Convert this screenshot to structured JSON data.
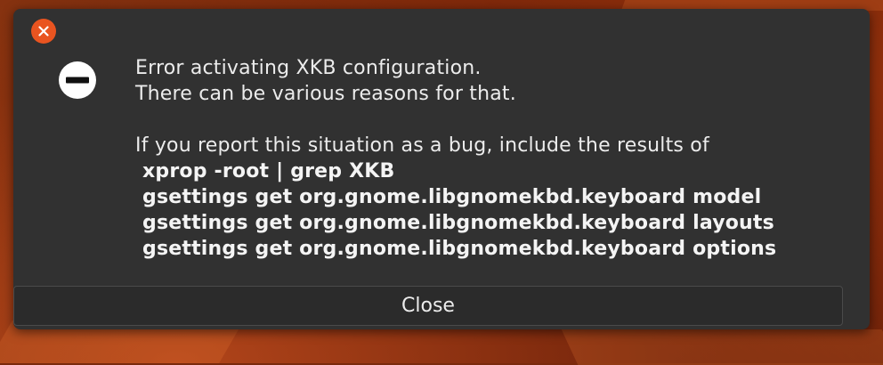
{
  "colors": {
    "accent": "#e95420",
    "dialog_bg": "#313131",
    "text": "#ececec"
  },
  "titlebar": {
    "close_icon": "close-icon"
  },
  "icon": {
    "name": "dialog-error-icon"
  },
  "message": {
    "line1": "Error activating XKB configuration.",
    "line2": "There can be various reasons for that.",
    "line3": "If you report this situation as a bug, include the results of",
    "commands": [
      "xprop -root | grep XKB",
      "gsettings get org.gnome.libgnomekbd.keyboard model",
      "gsettings get org.gnome.libgnomekbd.keyboard layouts",
      "gsettings get org.gnome.libgnomekbd.keyboard options"
    ]
  },
  "buttons": {
    "close_label": "Close"
  }
}
